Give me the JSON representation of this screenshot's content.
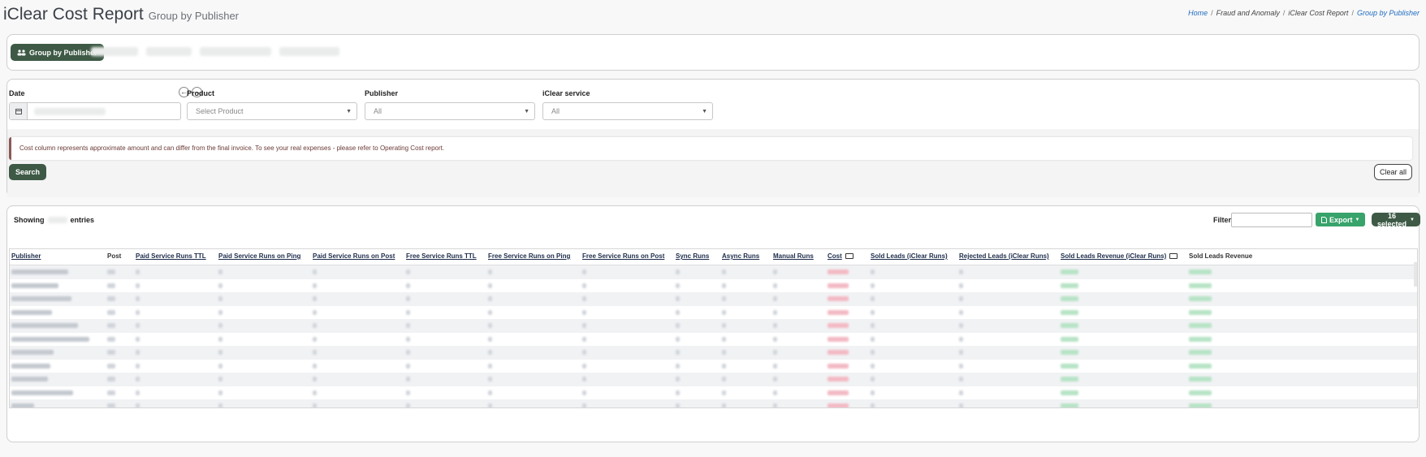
{
  "header": {
    "title": "iClear Cost Report",
    "subtitle": "Group by Publisher",
    "breadcrumb": [
      "Home",
      "Fraud and Anomaly",
      "iClear Cost Report",
      "Group by Publisher"
    ]
  },
  "group_tabs": {
    "active": "Group by Publisher"
  },
  "filters": {
    "date_label": "Date",
    "product_label": "Product",
    "product_placeholder": "Select Product",
    "publisher_label": "Publisher",
    "publisher_value": "All",
    "service_label": "iClear service",
    "service_value": "All"
  },
  "notice": "Cost column represents approximate amount and can differ from the final invoice. To see your real expenses - please refer to Operating Cost report.",
  "buttons": {
    "search": "Search",
    "clear_all": "Clear all",
    "export": "Export",
    "selected": "16 selected"
  },
  "table": {
    "showing_prefix": "Showing",
    "showing_suffix": "entries",
    "filter_label": "Filter:",
    "columns": [
      "Publisher",
      "Post",
      "Paid Service Runs TTL",
      "Paid Service Runs on Ping",
      "Paid Service Runs on Post",
      "Free Service Runs TTL",
      "Free Service Runs on Ping",
      "Free Service Runs on Post",
      "Sync Runs",
      "Async Runs",
      "Manual Runs",
      "Cost",
      "Sold Leads (iClear Runs)",
      "Rejected Leads (iClear Runs)",
      "Sold Leads Revenue (iClear Runs)",
      "Sold Leads Revenue"
    ],
    "row_count": 11
  },
  "colors": {
    "brand_dark": "#3e5a46",
    "export_green": "#38a36a",
    "link_blue": "#1f6cc2"
  }
}
